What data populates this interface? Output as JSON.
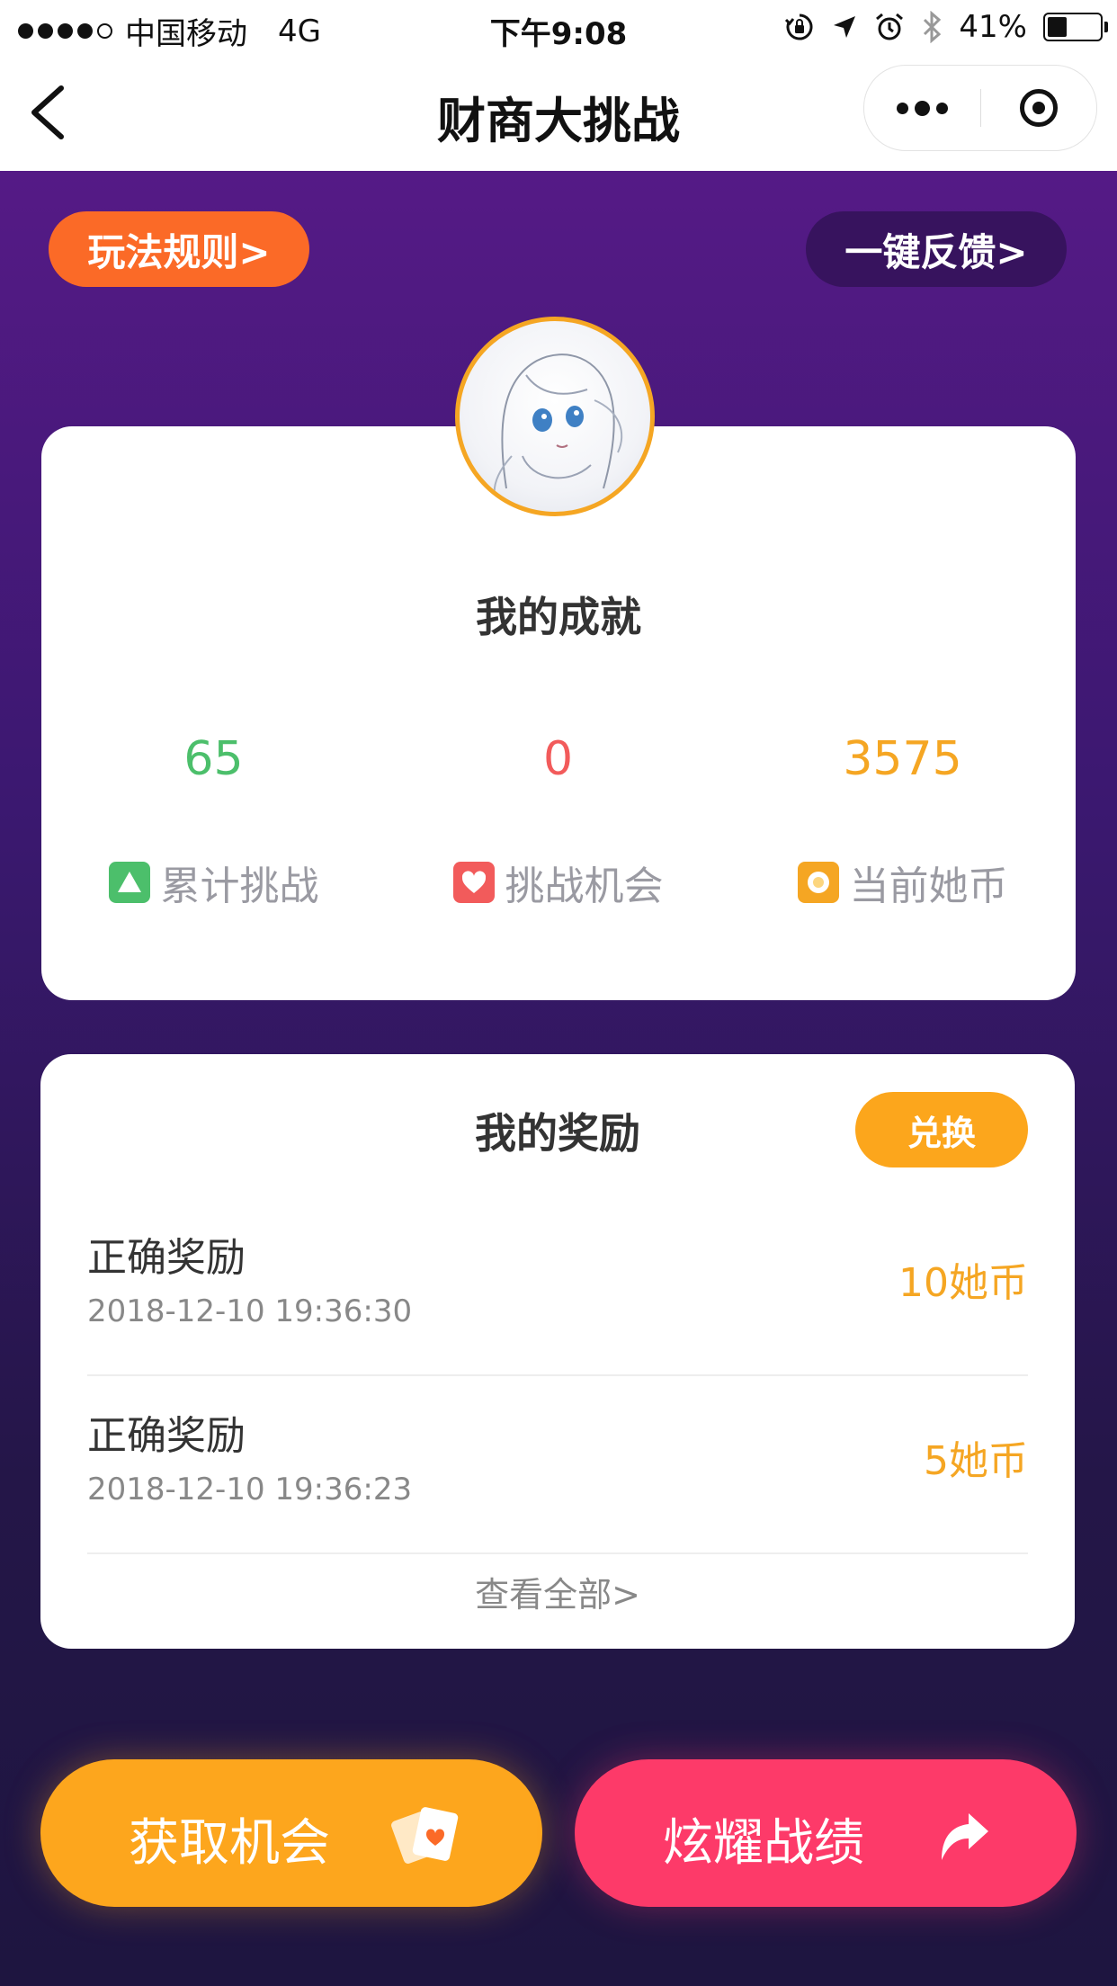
{
  "status_bar": {
    "carrier": "中国移动",
    "network": "4G",
    "time": "下午9:08",
    "battery_percent": "41%",
    "battery_level": 0.41
  },
  "nav": {
    "title": "财商大挑战"
  },
  "top_buttons": {
    "rules": "玩法规则>",
    "feedback": "一键反馈>"
  },
  "achievements": {
    "title": "我的成就",
    "stats": [
      {
        "value": "65",
        "label": "累计挑战",
        "color": "#4cbf6b",
        "icon": "triangle-icon"
      },
      {
        "value": "0",
        "label": "挑战机会",
        "color": "#f25b5b",
        "icon": "heart-icon"
      },
      {
        "value": "3575",
        "label": "当前她币",
        "color": "#f5a623",
        "icon": "coin-icon"
      }
    ]
  },
  "rewards": {
    "title": "我的奖励",
    "redeem": "兑换",
    "items": [
      {
        "title": "正确奖励",
        "time": "2018-12-10 19:36:30",
        "amount": "10她币"
      },
      {
        "title": "正确奖励",
        "time": "2018-12-10 19:36:23",
        "amount": "5她币"
      }
    ],
    "view_all": "查看全部>"
  },
  "bottom": {
    "get_chance": "获取机会",
    "show_off": "炫耀战绩"
  },
  "colors": {
    "accent_orange": "#fb6a27",
    "gold": "#f5a623",
    "pink": "#fd3a69",
    "purple_top": "#551a86",
    "purple_bottom": "#1e1540"
  }
}
